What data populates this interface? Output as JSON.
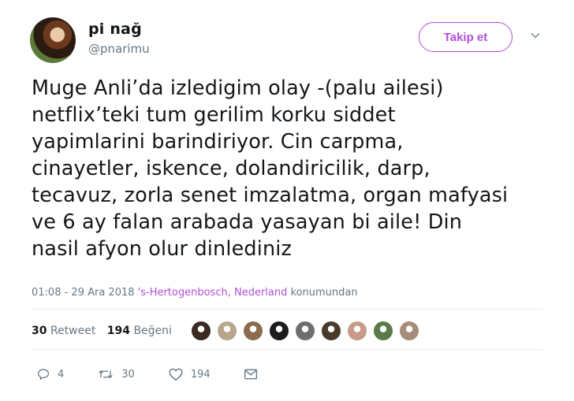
{
  "author": {
    "display_name": "pi nağ",
    "handle": "@pnarimu"
  },
  "follow_button": {
    "label": "Takip et",
    "color": "#b14fd8"
  },
  "tweet": {
    "text": "Muge Anli’da izledigim olay -(palu ailesi)\nnetflix’teki tum gerilim korku siddet\nyapimlarini barindiriyor. Cin carpma,\ncinayetler, iskence, dolandiricilik, darp,\ntecavuz, zorla senet imzalatma, organ mafyasi\nve 6 ay falan arabada yasayan bi aile! Din\nnasil afyon olur dinlediniz",
    "time": "01:08 - 29 Ara 2018",
    "location": "'s-Hertogenbosch, Nederland",
    "location_suffix": "konumundan"
  },
  "stats": {
    "retweet_count": "30",
    "retweet_label": "Retweet",
    "like_count": "194",
    "like_label": "Beğeni"
  },
  "liker_avatar_colors": [
    "#3a2a22",
    "#b7a58c",
    "#8c6c4e",
    "#1c1c1c",
    "#6e6e6e",
    "#4a3a2c",
    "#c89a88",
    "#5b7a4a",
    "#a68c7a"
  ],
  "actions": {
    "reply_icon": "reply-icon",
    "reply_count": "4",
    "retweet_icon": "retweet-icon",
    "retweet_count": "30",
    "like_icon": "heart-icon",
    "like_count": "194",
    "dm_icon": "envelope-icon"
  }
}
